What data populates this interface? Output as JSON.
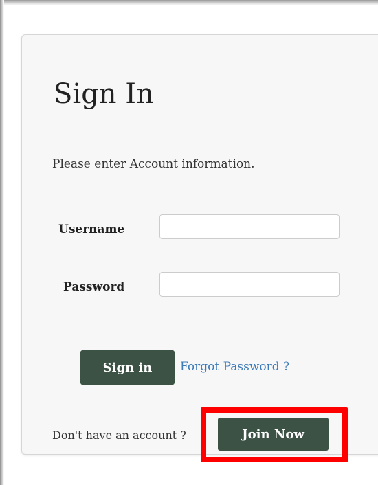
{
  "signin": {
    "title": "Sign In",
    "subtitle": "Please enter Account information.",
    "username_label": "Username",
    "username_value": "",
    "password_label": "Password",
    "password_value": "",
    "signin_button": "Sign in",
    "forgot_link": "Forgot Password ?",
    "no_account_text": "Don't have an account ?",
    "join_button": "Join Now"
  },
  "colors": {
    "button_bg": "#3b5244",
    "link": "#3d7ab8",
    "highlight": "#ff0000",
    "card_bg": "#f7f7f7"
  }
}
